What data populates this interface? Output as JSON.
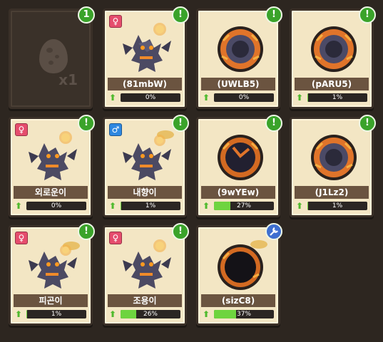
{
  "inventory": {
    "egg": {
      "count": "x1",
      "badge": "1"
    },
    "cards": [
      {
        "kind": "creature",
        "sex": "female",
        "name": "(81mbW)",
        "exp": "0%",
        "progress": 0,
        "badge": "!",
        "badge_color": "green"
      },
      {
        "kind": "egg-orb",
        "sex": "",
        "name": "(UWLB5)",
        "exp": "0%",
        "progress": 0,
        "badge": "!",
        "badge_color": "green"
      },
      {
        "kind": "egg-orb",
        "sex": "",
        "name": "(pARU5)",
        "exp": "1%",
        "progress": 1,
        "badge": "!",
        "badge_color": "green"
      },
      {
        "kind": "creature",
        "sex": "female",
        "name": "외로운이",
        "exp": "0%",
        "progress": 0,
        "badge": "!",
        "badge_color": "green"
      },
      {
        "kind": "creature",
        "sex": "male",
        "name": "내향이",
        "exp": "1%",
        "progress": 1,
        "badge": "!",
        "badge_color": "green",
        "hat": true
      },
      {
        "kind": "egg-orb-dark",
        "sex": "",
        "name": "(9wYEw)",
        "exp": "27%",
        "progress": 27,
        "badge": "!",
        "badge_color": "green"
      },
      {
        "kind": "egg-orb",
        "sex": "",
        "name": "(J1Lz2)",
        "exp": "1%",
        "progress": 1,
        "badge": "!",
        "badge_color": "green"
      },
      {
        "kind": "creature",
        "sex": "female",
        "name": "피곤이",
        "exp": "1%",
        "progress": 1,
        "badge": "!",
        "badge_color": "green",
        "hat": true
      },
      {
        "kind": "creature",
        "sex": "female",
        "name": "조용이",
        "exp": "26%",
        "progress": 26,
        "badge": "!",
        "badge_color": "green"
      },
      {
        "kind": "egg-orb-black",
        "sex": "",
        "name": "(sizC8)",
        "exp": "37%",
        "progress": 37,
        "badge": "wrench-icon",
        "badge_color": "blue",
        "hat": true
      }
    ]
  },
  "colors": {
    "card_bg": "#f3e6c4",
    "name_bar": "#6b5440",
    "exp_fill": "#6ed43f",
    "badge_green": "#3aa32a",
    "badge_blue": "#3e6fd0",
    "female": "#e54d6d",
    "male": "#2f88e0"
  }
}
